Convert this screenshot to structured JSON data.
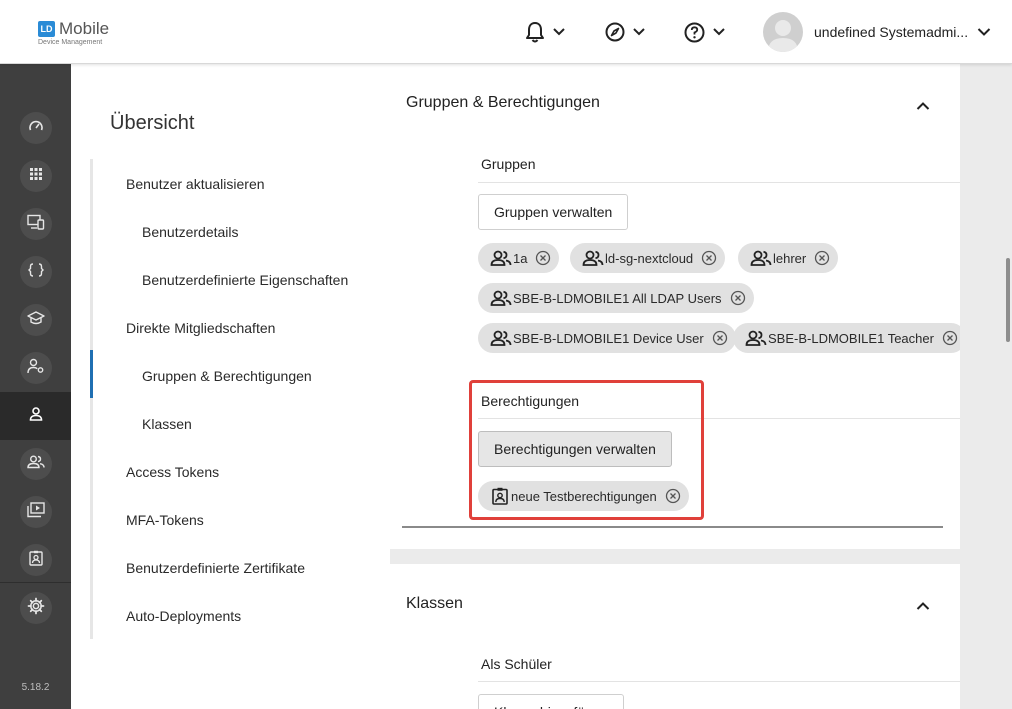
{
  "app": {
    "logo_mark": "LD",
    "logo_title": "Mobile",
    "logo_sub": "Device Management",
    "version": "5.18.2"
  },
  "header": {
    "user_name": "undefined Systemadmi...",
    "icons": [
      "bell-icon",
      "compass-icon",
      "help-icon"
    ]
  },
  "sidebar": {
    "items": [
      "dashboard-icon",
      "apps-grid-icon",
      "devices-icon",
      "code-icon",
      "school-icon",
      "user-settings-icon",
      "user-icon",
      "groups-icon",
      "media-icon",
      "badge-icon",
      "settings-icon"
    ],
    "active": "user-icon"
  },
  "overview": {
    "title": "Übersicht",
    "items": [
      {
        "label": "Benutzer aktualisieren",
        "level": 1
      },
      {
        "label": "Benutzerdetails",
        "level": 2
      },
      {
        "label": "Benutzerdefinierte Eigenschaften",
        "level": 2
      },
      {
        "label": "Direkte Mitgliedschaften",
        "level": 1
      },
      {
        "label": "Gruppen & Berechtigungen",
        "level": 2,
        "active": true
      },
      {
        "label": "Klassen",
        "level": 2
      },
      {
        "label": "Access Tokens",
        "level": 1
      },
      {
        "label": "MFA-Tokens",
        "level": 1
      },
      {
        "label": "Benutzerdefinierte Zertifikate",
        "level": 1
      },
      {
        "label": "Auto-Deployments",
        "level": 1
      }
    ]
  },
  "groups_section": {
    "title": "Gruppen & Berechtigungen",
    "groups_label": "Gruppen",
    "manage_groups_button": "Gruppen verwalten",
    "group_chips": [
      "1a",
      "ld-sg-nextcloud",
      "lehrer",
      "SBE-B-LDMOBILE1 All LDAP Users",
      "SBE-B-LDMOBILE1 Device User",
      "SBE-B-LDMOBILE1 Teacher"
    ],
    "permissions_label": "Berechtigungen",
    "manage_permissions_button": "Berechtigungen verwalten",
    "permission_chips": [
      "neue Testberechtigungen"
    ]
  },
  "classes_section": {
    "title": "Klassen",
    "student_label": "Als Schüler",
    "add_button": "Klasse hinzufügen"
  },
  "colors": {
    "accent": "#1f6fb2",
    "highlight": "#e0403a",
    "rail_bg": "#3f3f3f"
  }
}
